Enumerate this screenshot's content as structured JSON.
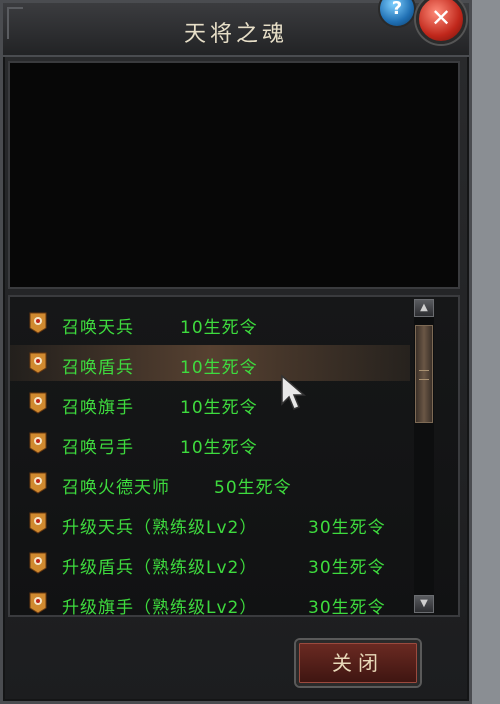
{
  "window": {
    "title": "天将之魂",
    "help_label": "?",
    "close_x_label": "✕"
  },
  "list": {
    "items": [
      {
        "label": "召唤天兵",
        "cost": "10生死令"
      },
      {
        "label": "召唤盾兵",
        "cost": "10生死令"
      },
      {
        "label": "召唤旗手",
        "cost": "10生死令"
      },
      {
        "label": "召唤弓手",
        "cost": "10生死令"
      },
      {
        "label": "召唤火德天师",
        "cost": "50生死令"
      },
      {
        "label": "升级天兵（熟练级Lv2）",
        "cost": "30生死令"
      },
      {
        "label": "升级盾兵（熟练级Lv2）",
        "cost": "30生死令"
      },
      {
        "label": "升级旗手（熟练级Lv2）",
        "cost": "30生死令"
      }
    ],
    "scroll_up_icon": "▲",
    "scroll_down_icon": "▼"
  },
  "footer": {
    "close_label": "关闭"
  },
  "colors": {
    "item_text": "#3edb3e",
    "accent_red": "#c0271b"
  }
}
